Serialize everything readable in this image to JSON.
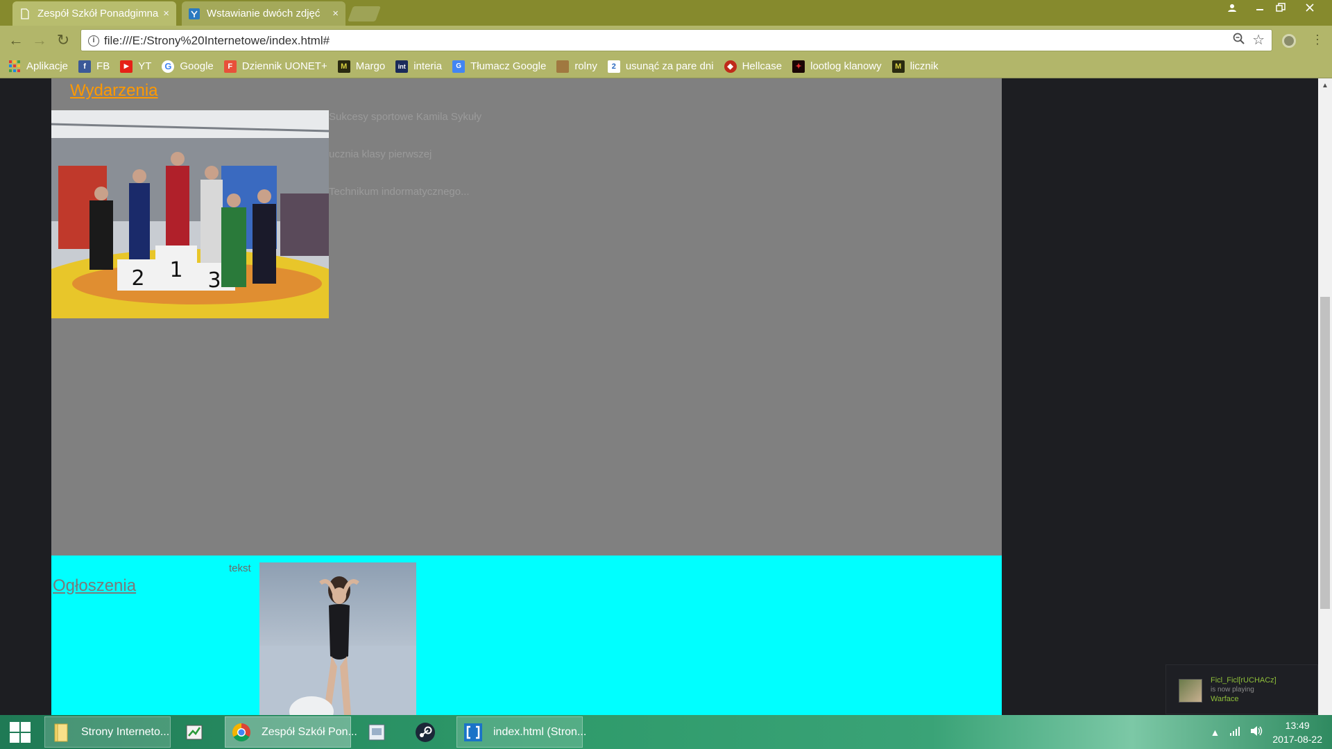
{
  "browser": {
    "tabs": [
      {
        "title": "Zespół Szkół Ponadgimnazjalnych",
        "active": true
      },
      {
        "title": "Wstawianie dwóch zdjęć",
        "active": false
      }
    ],
    "close_glyph": "×",
    "url": "file:///E:/Strony%20Internetowe/index.html#",
    "nav": {
      "back": "←",
      "forward": "→",
      "reload": "↻"
    },
    "bookmarks": [
      {
        "label": "Aplikacje",
        "icon": "apps-icon",
        "color": "#e53935"
      },
      {
        "label": "FB",
        "icon": "facebook-icon",
        "color": "#3b5998"
      },
      {
        "label": "YT",
        "icon": "youtube-icon",
        "color": "#e62117"
      },
      {
        "label": "Google",
        "icon": "google-icon",
        "color": "#4285f4"
      },
      {
        "label": "Dziennik UONET+",
        "icon": "uonet-icon",
        "color": "#e8503a"
      },
      {
        "label": "Margo",
        "icon": "margo-icon",
        "color": "#3a3a1a"
      },
      {
        "label": "interia",
        "icon": "interia-icon",
        "color": "#1a2a5a"
      },
      {
        "label": "Tłumacz Google",
        "icon": "translate-icon",
        "color": "#4285f4"
      },
      {
        "label": "rolny",
        "icon": "rolny-icon",
        "color": "#a07840"
      },
      {
        "label": "usunąć za pare dni",
        "icon": "bookmark-site-icon",
        "color": "#2a6ac0"
      },
      {
        "label": "Hellcase",
        "icon": "hellcase-icon",
        "color": "#c02a1a"
      },
      {
        "label": "lootlog klanowy",
        "icon": "lootlog-icon",
        "color": "#2a0a0a"
      },
      {
        "label": "licznik",
        "icon": "licznik-icon",
        "color": "#3a3a1a"
      }
    ]
  },
  "page": {
    "events": {
      "title": "Wydarzenia",
      "lines": [
        "Sukcesy sportowe Kamila Sykuły",
        "ucznia klasy pierwszej",
        "Technikum indormatycznego..."
      ]
    },
    "announcements": {
      "title": "Ogłoszenia",
      "text": "tekst"
    }
  },
  "notification": {
    "user": "Ficl_Ficl[rUCHACz]",
    "status": "is now playing",
    "game": "Warface"
  },
  "taskbar": {
    "items": [
      {
        "label": "Strony Interneto...",
        "icon": "folder-icon"
      },
      {
        "label": "",
        "icon": "spreadsheet-app-icon"
      },
      {
        "label": "Zespół Szkół Pon...",
        "icon": "chrome-icon"
      },
      {
        "label": "",
        "icon": "document-viewer-icon"
      },
      {
        "label": "",
        "icon": "steam-icon"
      },
      {
        "label": "index.html (Stron...",
        "icon": "brackets-icon"
      }
    ],
    "time": "13:49",
    "date": "2017-08-22"
  }
}
